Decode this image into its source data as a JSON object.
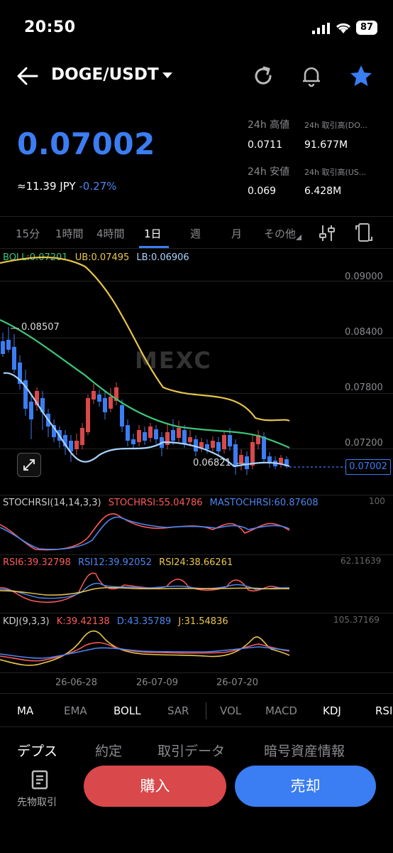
{
  "status_bar": {
    "time": "20:50",
    "battery": "87"
  },
  "header": {
    "pair": "DOGE/USDT"
  },
  "ticker": {
    "price": "0.07002",
    "jpy": "≈11.39 JPY",
    "change": "-0.27%",
    "high_label": "24h 高値",
    "high_value": "0.0711",
    "low_label": "24h 安値",
    "low_value": "0.069",
    "vol_base_label": "24h 取引高(DO...",
    "vol_base_value": "91.677M",
    "vol_quote_label": "24h 取引高(US...",
    "vol_quote_value": "6.428M"
  },
  "timeframes": {
    "items": [
      "15分",
      "1時間",
      "4時間",
      "1日",
      "週",
      "月",
      "その他"
    ],
    "active": "1日"
  },
  "boll": {
    "boll": "BOLL:0.07201",
    "ub": "UB:0.07495",
    "lb": "LB:0.06906"
  },
  "price_axis": [
    "0.09000",
    "0.08400",
    "0.07800",
    "0.07200"
  ],
  "current_price_tag": "0.07002",
  "annotations": {
    "high": "0.08507",
    "low": "0.06821"
  },
  "watermark": "MEXC",
  "stochrsi": {
    "title": "STOCHRSI(14,14,3,3)",
    "value": "STOCHRSI:55.04786",
    "ma": "MASTOCHRSI:60.87608",
    "axis_max": "100"
  },
  "rsi": {
    "rsi6": "RSI6:39.32798",
    "rsi12": "RSI12:39.92052",
    "rsi24": "RSI24:38.66261",
    "axis_max": "62.11639"
  },
  "kdj": {
    "title": "KDJ(9,3,3)",
    "k": "K:39.42138",
    "d": "D:43.35789",
    "j": "J:31.54836",
    "axis_max": "105.37169"
  },
  "dates": [
    "26-06-28",
    "26-07-09",
    "26-07-20"
  ],
  "indicator_tabs": [
    "MA",
    "EMA",
    "BOLL",
    "SAR",
    "VOL",
    "MACD",
    "KDJ",
    "RSI"
  ],
  "bottom_tabs": [
    "デプス",
    "約定",
    "取引データ",
    "暗号資産情報"
  ],
  "actions": {
    "futures": "先物取引",
    "buy": "購入",
    "sell": "売却"
  },
  "colors": {
    "accent": "#3b7df2",
    "buy": "#d9484a",
    "sell": "#3b7df2",
    "boll_mid": "#3ec478",
    "boll_ub": "#e9c64a",
    "boll_lb": "#a9d4ff",
    "up": "#d9484a",
    "down": "#3b7df2"
  }
}
